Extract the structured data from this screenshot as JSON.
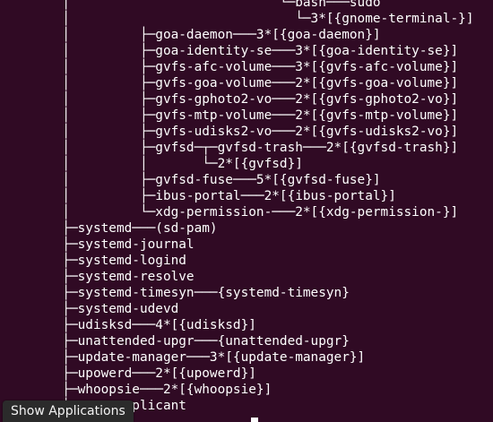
{
  "terminal": {
    "lines": [
      "        │                           └─bash───sudo",
      "        │                             └─3*[{gnome-terminal-}]",
      "        │         ├─goa-daemon───3*[{goa-daemon}]",
      "        │         ├─goa-identity-se───3*[{goa-identity-se}]",
      "        │         ├─gvfs-afc-volume───3*[{gvfs-afc-volume}]",
      "        │         ├─gvfs-goa-volume───2*[{gvfs-goa-volume}]",
      "        │         ├─gvfs-gphoto2-vo───2*[{gvfs-gphoto2-vo}]",
      "        │         ├─gvfs-mtp-volume───2*[{gvfs-mtp-volume}]",
      "        │         ├─gvfs-udisks2-vo───2*[{gvfs-udisks2-vo}]",
      "        │         ├─gvfsd─┬─gvfsd-trash───2*[{gvfsd-trash}]",
      "        │         │       └─2*[{gvfsd}]",
      "        │         ├─gvfsd-fuse───5*[{gvfsd-fuse}]",
      "        │         ├─ibus-portal───2*[{ibus-portal}]",
      "        │         └─xdg-permission-───2*[{xdg-permission-}]",
      "        ├─systemd───(sd-pam)",
      "        ├─systemd-journal",
      "        ├─systemd-logind",
      "        ├─systemd-resolve",
      "        ├─systemd-timesyn───{systemd-timesyn}",
      "        ├─systemd-udevd",
      "        ├─udisksd───4*[{udisksd}]",
      "        ├─unattended-upgr───{unattended-upgr}",
      "        ├─update-manager───3*[{update-manager}]",
      "        ├─upowerd───2*[{upowerd}]",
      "        ├─whoopsie───2*[{whoopsie}]",
      "        └─wpa_supplicant"
    ]
  },
  "tooltip": {
    "label": "Show Applications"
  },
  "colors": {
    "background": "#300a24",
    "foreground": "#ffffff"
  }
}
